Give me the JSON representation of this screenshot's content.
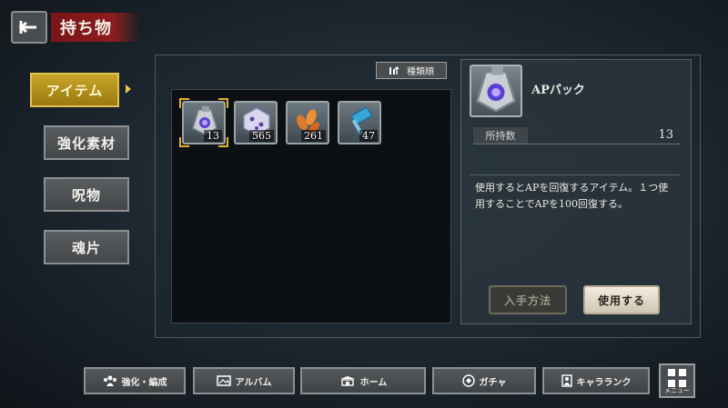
{
  "header": {
    "title": "持ち物"
  },
  "sidebar": {
    "items": [
      {
        "label": "アイテム",
        "active": true
      },
      {
        "label": "強化素材",
        "active": false
      },
      {
        "label": "呪物",
        "active": false
      },
      {
        "label": "魂片",
        "active": false
      }
    ]
  },
  "sort": {
    "label": "種類順"
  },
  "items": [
    {
      "icon": "ap-pack-icon",
      "quantity": "13",
      "selected": true
    },
    {
      "icon": "crystal-dice-icon",
      "quantity": "565",
      "selected": false
    },
    {
      "icon": "orange-petals-icon",
      "quantity": "261",
      "selected": false
    },
    {
      "icon": "blue-hammer-icon",
      "quantity": "47",
      "selected": false
    }
  ],
  "detail": {
    "name": "APパック",
    "owned_label": "所持数",
    "owned_value": "13",
    "description": "使用するとAPを回復するアイテム。１つ使用することでAPを100回復する。",
    "acquire_label": "入手方法",
    "use_label": "使用する"
  },
  "bottom_nav": [
    {
      "label": "強化・編成",
      "icon": "party-icon"
    },
    {
      "label": "アルバム",
      "icon": "album-icon"
    },
    {
      "label": "ホーム",
      "icon": "home-icon"
    },
    {
      "label": "ガチャ",
      "icon": "gacha-icon"
    },
    {
      "label": "キャラランク",
      "icon": "character-rank-icon"
    }
  ],
  "menu": {
    "label": "メニュー"
  },
  "colors": {
    "accent_gold": "#e6b422",
    "title_red": "#8c1c1e"
  }
}
